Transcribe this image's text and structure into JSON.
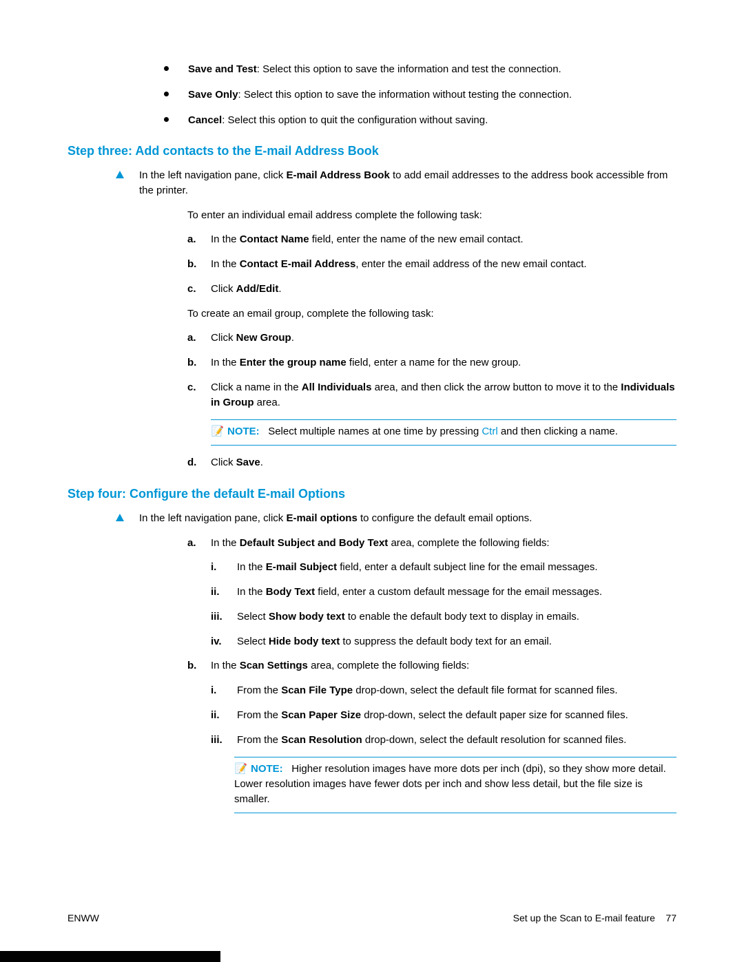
{
  "bullets": {
    "save_test": {
      "bold": "Save and Test",
      "text": ": Select this option to save the information and test the connection."
    },
    "save_only": {
      "bold": "Save Only",
      "text": ": Select this option to save the information without testing the connection."
    },
    "cancel": {
      "bold": "Cancel",
      "text": ": Select this option to quit the configuration without saving."
    }
  },
  "step3": {
    "heading": "Step three: Add contacts to the E-mail Address Book",
    "intro_pre": "In the left navigation pane, click ",
    "intro_bold": "E-mail Address Book",
    "intro_post": " to add email addresses to the address book accessible from the printer.",
    "sub1": "To enter an individual email address complete the following task:",
    "a_pre": "In the ",
    "a_bold": "Contact Name",
    "a_post": " field, enter the name of the new email contact.",
    "b_pre": "In the ",
    "b_bold": "Contact E-mail Address",
    "b_post": ", enter the email address of the new email contact.",
    "c_pre": "Click ",
    "c_bold": "Add/Edit",
    "c_post": ".",
    "sub2": "To create an email group, complete the following task:",
    "ga_pre": "Click ",
    "ga_bold": "New Group",
    "ga_post": ".",
    "gb_pre": "In the ",
    "gb_bold": "Enter the group name",
    "gb_post": " field, enter a name for the new group.",
    "gc_pre": "Click a name in the ",
    "gc_bold": "All Individuals",
    "gc_mid": " area, and then click the arrow button to move it to the ",
    "gc_bold2": "Individuals in Group",
    "gc_post": " area.",
    "note_label": "NOTE:",
    "note_pre": "Select multiple names at one time by pressing ",
    "note_ctrl": "Ctrl",
    "note_post": " and then clicking a name.",
    "gd_pre": "Click ",
    "gd_bold": "Save",
    "gd_post": "."
  },
  "step4": {
    "heading": "Step four: Configure the default E-mail Options",
    "intro_pre": "In the left navigation pane, click ",
    "intro_bold": "E-mail options",
    "intro_post": " to configure the default email options.",
    "a_pre": "In the ",
    "a_bold": "Default Subject and Body Text",
    "a_post": " area, complete the following fields:",
    "ai_pre": "In the ",
    "ai_bold": "E-mail Subject",
    "ai_post": " field, enter a default subject line for the email messages.",
    "aii_pre": "In the ",
    "aii_bold": "Body Text",
    "aii_post": " field, enter a custom default message for the email messages.",
    "aiii_pre": "Select ",
    "aiii_bold": "Show body text",
    "aiii_post": " to enable the default body text to display in emails.",
    "aiv_pre": "Select ",
    "aiv_bold": "Hide body text",
    "aiv_post": " to suppress the default body text for an email.",
    "b_pre": "In the ",
    "b_bold": "Scan Settings",
    "b_post": " area, complete the following fields:",
    "bi_pre": "From the ",
    "bi_bold": "Scan File Type",
    "bi_post": " drop-down, select the default file format for scanned files.",
    "bii_pre": "From the ",
    "bii_bold": "Scan Paper Size",
    "bii_post": " drop-down, select the default paper size for scanned files.",
    "biii_pre": "From the ",
    "biii_bold": "Scan Resolution",
    "biii_post": " drop-down, select the default resolution for scanned files.",
    "note_label": "NOTE:",
    "note_text": "Higher resolution images have more dots per inch (dpi), so they show more detail. Lower resolution images have fewer dots per inch and show less detail, but the file size is smaller."
  },
  "markers": {
    "a": "a.",
    "b": "b.",
    "c": "c.",
    "d": "d.",
    "i": "i.",
    "ii": "ii.",
    "iii": "iii.",
    "iv": "iv."
  },
  "footer": {
    "left": "ENWW",
    "right_text": "Set up the Scan to E-mail feature",
    "page": "77"
  }
}
